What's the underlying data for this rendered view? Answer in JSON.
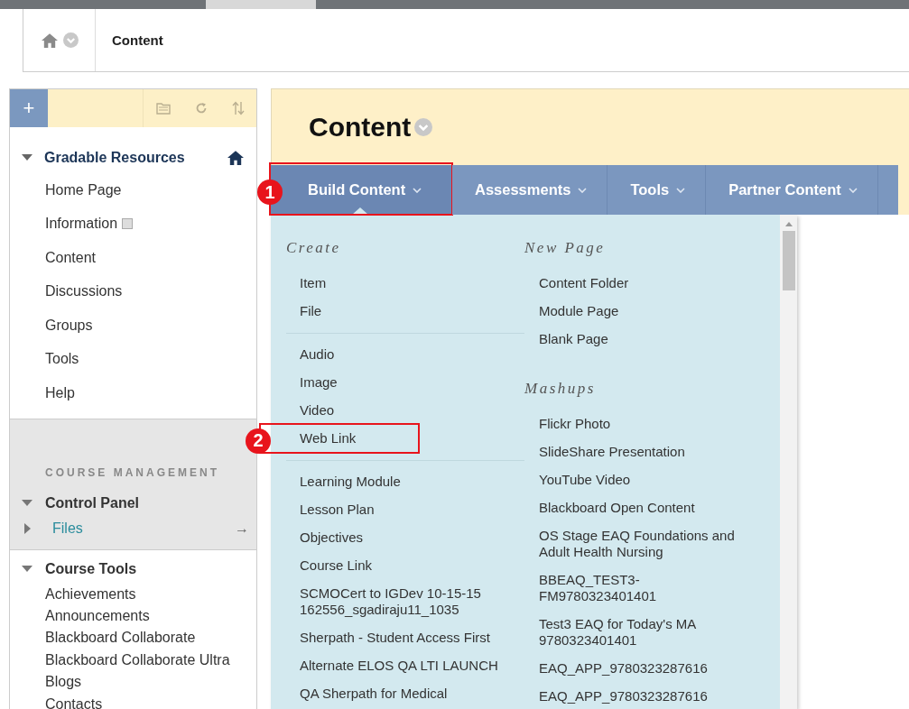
{
  "breadcrumb": {
    "current": "Content"
  },
  "sidebar": {
    "toolbar": {
      "add_label": "+"
    },
    "menu_title": "Gradable Resources",
    "items": [
      {
        "label": "Home Page",
        "has_icon": false
      },
      {
        "label": "Information",
        "has_icon": true
      },
      {
        "label": "Content",
        "has_icon": false
      },
      {
        "label": "Discussions",
        "has_icon": false
      },
      {
        "label": "Groups",
        "has_icon": false
      },
      {
        "label": "Tools",
        "has_icon": false
      },
      {
        "label": "Help",
        "has_icon": false
      }
    ],
    "management": {
      "heading": "COURSE MANAGEMENT",
      "panel_title": "Control Panel",
      "files_label": "Files",
      "files_arrow": "→"
    },
    "course_tools": {
      "title": "Course Tools",
      "items": [
        "Achievements",
        "Announcements",
        "Blackboard Collaborate",
        "Blackboard Collaborate Ultra",
        "Blogs",
        "Contacts"
      ]
    }
  },
  "page": {
    "title": "Content"
  },
  "tabs": [
    {
      "label": "Build Content",
      "selected": true,
      "highlighted": true,
      "callout": "1"
    },
    {
      "label": "Assessments",
      "selected": false,
      "highlighted": false
    },
    {
      "label": "Tools",
      "selected": false,
      "highlighted": false
    },
    {
      "label": "Partner Content",
      "selected": false,
      "highlighted": false
    }
  ],
  "dropdown": {
    "columns": [
      {
        "sections": [
          {
            "heading": "Create",
            "items": [
              {
                "label": "Item",
                "highlighted": false
              },
              {
                "label": "File",
                "highlighted": false
              }
            ]
          },
          {
            "items": [
              {
                "label": "Audio",
                "highlighted": false
              },
              {
                "label": "Image",
                "highlighted": false
              },
              {
                "label": "Video",
                "highlighted": false
              },
              {
                "label": "Web Link",
                "highlighted": true,
                "callout": "2"
              }
            ]
          },
          {
            "items": [
              {
                "label": "Learning Module",
                "highlighted": false
              },
              {
                "label": "Lesson Plan",
                "highlighted": false
              },
              {
                "label": "Objectives",
                "highlighted": false
              },
              {
                "label": "Course Link",
                "highlighted": false
              },
              {
                "label": "SCMOCert to IGDev 10-15-15 162556_sgadiraju11_1035",
                "highlighted": false
              },
              {
                "label": "Sherpath - Student Access First",
                "highlighted": false
              },
              {
                "label": "Alternate ELOS QA LTI LAUNCH",
                "highlighted": false
              },
              {
                "label": "QA Sherpath for Medical",
                "highlighted": false
              }
            ]
          }
        ]
      },
      {
        "sections": [
          {
            "heading": "New Page",
            "items": [
              {
                "label": "Content Folder",
                "highlighted": false
              },
              {
                "label": "Module Page",
                "highlighted": false
              },
              {
                "label": "Blank Page",
                "highlighted": false
              }
            ]
          },
          {
            "heading": "Mashups",
            "items": [
              {
                "label": "Flickr Photo",
                "highlighted": false
              },
              {
                "label": "SlideShare Presentation",
                "highlighted": false
              },
              {
                "label": "YouTube Video",
                "highlighted": false
              },
              {
                "label": "Blackboard Open Content",
                "highlighted": false
              },
              {
                "label": "OS Stage EAQ Foundations and Adult Health Nursing",
                "highlighted": false
              },
              {
                "label": "BBEAQ_TEST3-FM9780323401401",
                "highlighted": false
              },
              {
                "label": "Test3 EAQ for Today's MA 9780323401401",
                "highlighted": false
              },
              {
                "label": "EAQ_APP_9780323287616",
                "highlighted": false
              },
              {
                "label": "EAQ_APP_9780323287616",
                "highlighted": false
              }
            ]
          }
        ]
      }
    ]
  }
}
